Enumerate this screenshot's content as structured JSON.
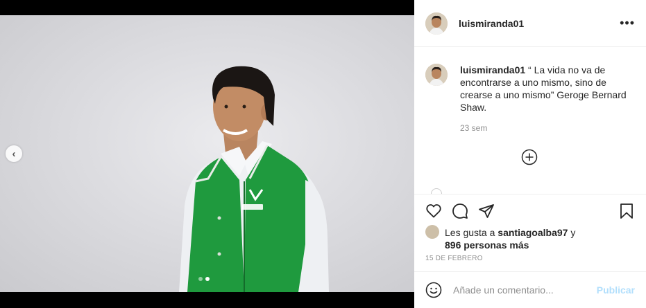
{
  "post": {
    "username": "luismiranda01",
    "caption": "“ La vida no va de encontrarse a uno mismo, sino de crearse a uno mismo” Geroge Bernard Shaw.",
    "time_ago": "23 sem",
    "date": "15 DE FEBRERO",
    "carousel": {
      "current": 2,
      "total": 2
    }
  },
  "likes": {
    "prefix": "Les gusta a ",
    "liker": "santiagoalba97",
    "conj": " y",
    "others": "896 personas más"
  },
  "comment_box": {
    "placeholder": "Añade un comentario...",
    "publish_label": "Publicar"
  },
  "colors": {
    "vest": "#1f9a3e",
    "publish_disabled": "#b2dffc",
    "text": "#262626",
    "muted": "#8e8e8e"
  },
  "icons": [
    "chevron-left-icon",
    "more-icon",
    "add-comment-icon",
    "heart-icon",
    "comment-icon",
    "share-icon",
    "bookmark-icon",
    "emoji-icon"
  ]
}
